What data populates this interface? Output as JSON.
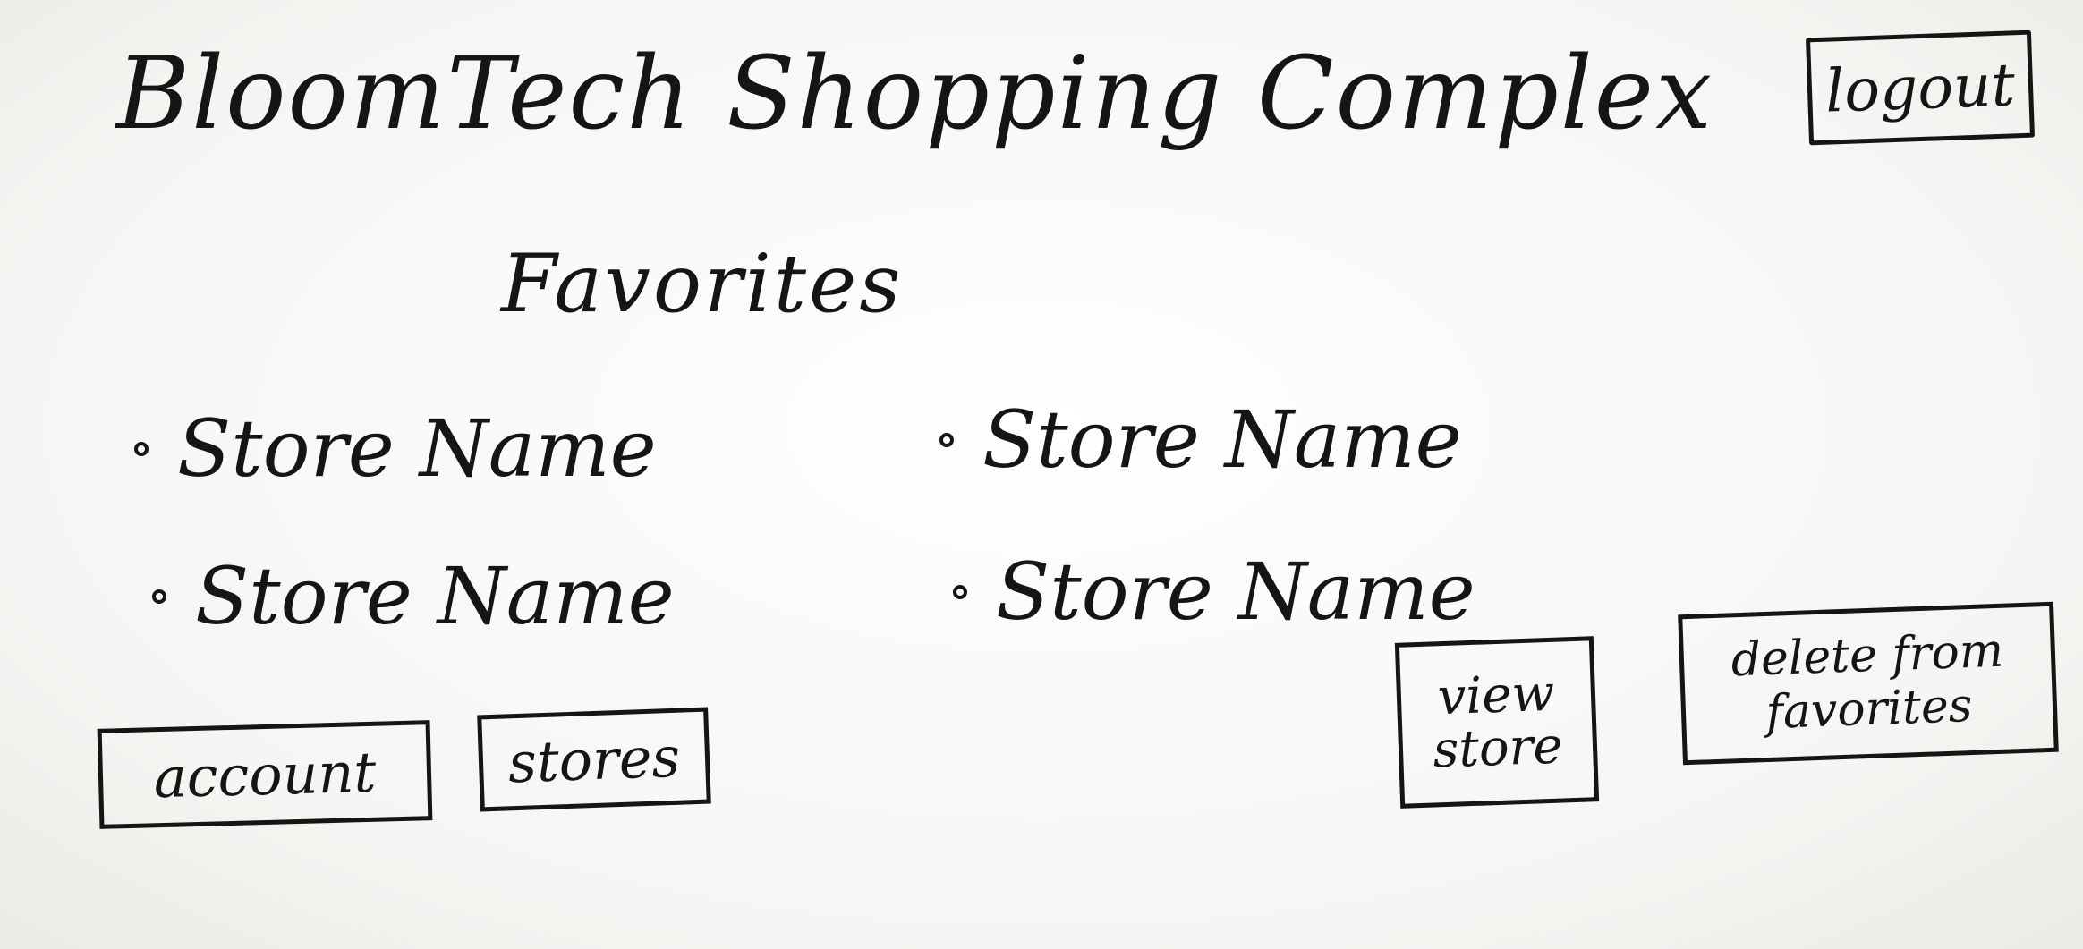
{
  "header": {
    "title": "BloomTech Shopping Complex",
    "logout_label": "logout"
  },
  "main": {
    "heading": "Favorites",
    "favorites": [
      {
        "name": "Store Name"
      },
      {
        "name": "Store Name"
      },
      {
        "name": "Store Name"
      },
      {
        "name": "Store Name"
      }
    ]
  },
  "nav": {
    "account_label": "account",
    "stores_label": "stores"
  },
  "actions": {
    "view_store_label": "view store",
    "delete_label": "delete from favorites"
  }
}
